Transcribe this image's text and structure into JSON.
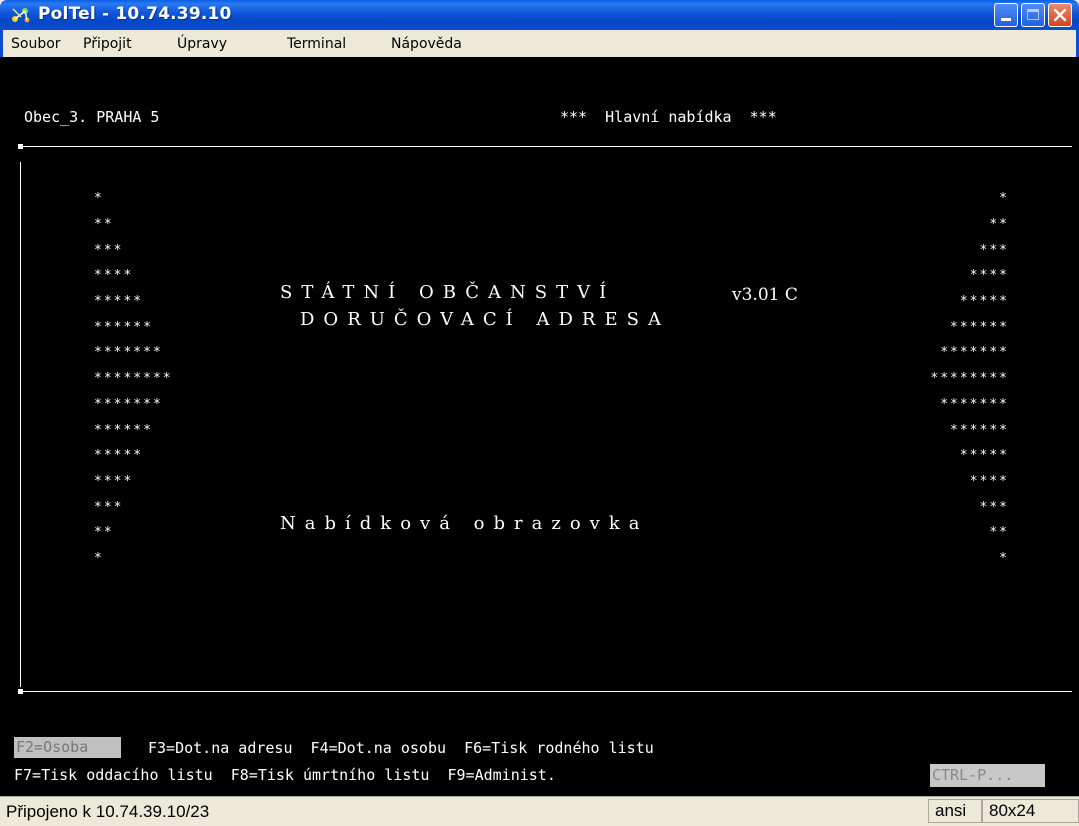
{
  "window": {
    "title": "PolTel - 10.74.39.10",
    "colors": {
      "titlebar": "#0a4bd0",
      "close": "#d3441f",
      "terminal_bg": "#000000",
      "terminal_fg": "#ffffff"
    }
  },
  "menu": {
    "items": [
      "Soubor",
      "Připojit",
      "Úpravy",
      "Terminal",
      "Nápověda"
    ]
  },
  "terminal": {
    "header_left": "Obec_3. PRAHA 5",
    "header_right": "***  Hlavní nabídka  ***",
    "title1": "STÁTNÍ OBČANSTVÍ",
    "version": "v3.01 C",
    "title2": "DORUČOVACÍ ADRESA",
    "subtitle": "Nabídková obrazovka",
    "stars_left": [
      "*",
      "**",
      "***",
      "****",
      "*****",
      "******",
      "*******",
      "********",
      "*******",
      "******",
      "*****",
      "****",
      "***",
      "**",
      "*"
    ],
    "stars_right": [
      "*",
      "**",
      "***",
      "****",
      "*****",
      "******",
      "*******",
      "********",
      "*******",
      "******",
      "*****",
      "****",
      "***",
      "**",
      "*"
    ],
    "fkeys_line1": {
      "f2": "F2=Osoba",
      "rest": "F3=Dot.na adresu  F4=Dot.na osobu  F6=Tisk rodného listu"
    },
    "fkeys_line2": "F7=Tisk oddacího listu  F8=Tisk úmrtního listu  F9=Administ.",
    "ctrl_hint": "CTRL-P..."
  },
  "status": {
    "connection": "Připojeno k 10.74.39.10/23",
    "emulation": "ansi",
    "size": "80x24"
  }
}
